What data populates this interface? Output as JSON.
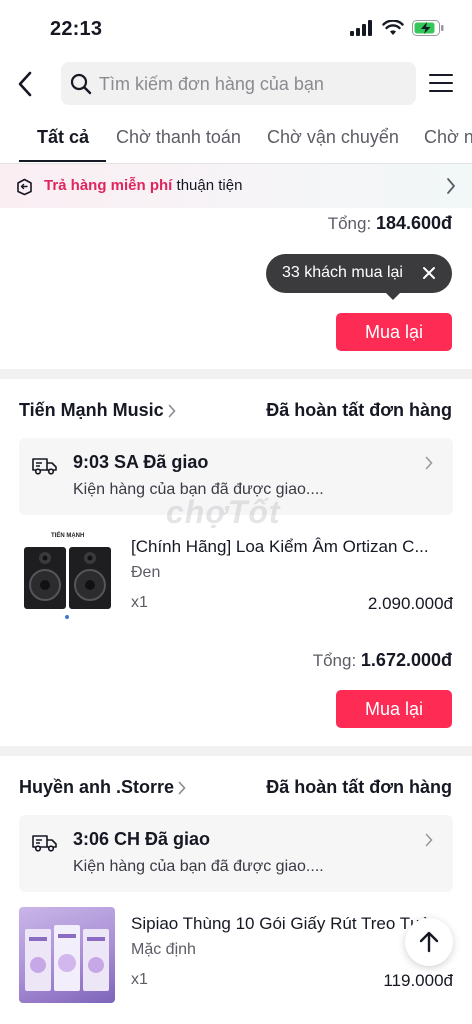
{
  "status_bar": {
    "time": "22:13"
  },
  "header": {
    "search_placeholder": "Tìm kiếm đơn hàng của bạn"
  },
  "tabs": [
    {
      "label": "Tất cả",
      "active": true
    },
    {
      "label": "Chờ thanh toán",
      "active": false
    },
    {
      "label": "Chờ vận chuyển",
      "active": false
    },
    {
      "label": "Chờ n",
      "active": false
    }
  ],
  "banner": {
    "highlight": "Trả hàng miễn phí",
    "text": "thuận tiện"
  },
  "prev_order": {
    "total_label": "Tổng:",
    "total_value": "184.600đ",
    "tooltip": "33 khách mua lại",
    "rebuy_label": "Mua lại"
  },
  "orders": [
    {
      "shop_name": "Tiến Mạnh Music",
      "status": "Đã hoàn tất đơn hàng",
      "shipping_title": "9:03 SA Đã giao",
      "shipping_sub": "Kiện hàng của bạn đã được giao....",
      "product_title": "[Chính Hãng] Loa Kiểm Âm Ortizan C...",
      "variant": "Đen",
      "qty": "x1",
      "price": "2.090.000đ",
      "total_label": "Tổng:",
      "total_value": "1.672.000đ",
      "rebuy_label": "Mua lại",
      "image_brand": "TIẾN MẠNH"
    },
    {
      "shop_name": "Huyền anh .Storre",
      "status": "Đã hoàn tất đơn hàng",
      "shipping_title": "3:06 CH Đã giao",
      "shipping_sub": "Kiện hàng của bạn đã được giao....",
      "product_title": "Sipiao Thùng 10 Gói Giấy Rút Treo Tườ",
      "variant": "Mặc định",
      "qty": "x1",
      "price": "119.000đ"
    }
  ],
  "watermark": "chợTốt",
  "colors": {
    "accent": "#fe2c55",
    "highlight": "#e0245e",
    "tooltip_bg": "#3b3b3d"
  },
  "icons": [
    "back-arrow-icon",
    "search-icon",
    "hamburger-menu-icon",
    "return-box-icon",
    "chevron-right-icon",
    "close-icon",
    "delivery-truck-icon",
    "arrow-up-icon",
    "signal-icon",
    "wifi-icon",
    "battery-charging-icon"
  ]
}
